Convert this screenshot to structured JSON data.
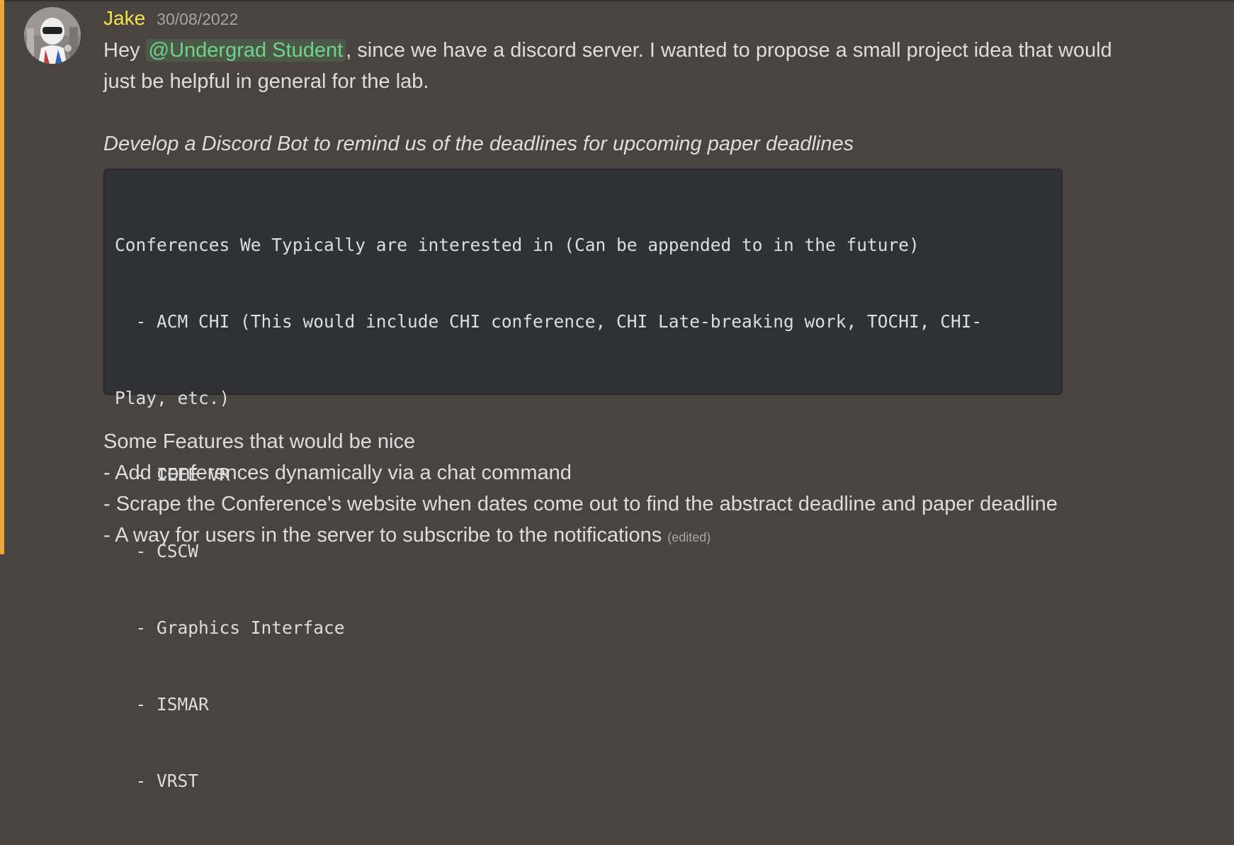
{
  "message": {
    "author": "Jake",
    "timestamp": "30/08/2022",
    "avatar_icon": "avatar-icon",
    "highlight_color": "#e9a93a",
    "username_color": "#f2e24b",
    "mention_color": "#6fd48a",
    "line1_prefix": "Hey ",
    "mention": "@Undergrad Student",
    "line1_suffix": ", since we have a discord server. I wanted to propose a small project idea that would",
    "line2": "just be helpful in general for the lab.",
    "italic_line": "Develop a Discord Bot to remind us of the deadlines for upcoming paper deadlines",
    "code_lines": [
      "Conferences We Typically are interested in (Can be appended to in the future)",
      "  - ACM CHI (This would include CHI conference, CHI Late-breaking work, TOCHI, CHI-",
      "Play, etc.)",
      "  - IEEE VR",
      "  - CSCW",
      "  - Graphics Interface",
      "  - ISMAR",
      "  - VRST"
    ],
    "features": [
      "Some Features that would be nice",
      "- Add conferences dynamically via a chat command",
      "- Scrape the Conference's website when dates come out to find the abstract deadline and paper deadline",
      "- A way for users in the server to subscribe to the notifications"
    ],
    "edited_label": "(edited)"
  }
}
